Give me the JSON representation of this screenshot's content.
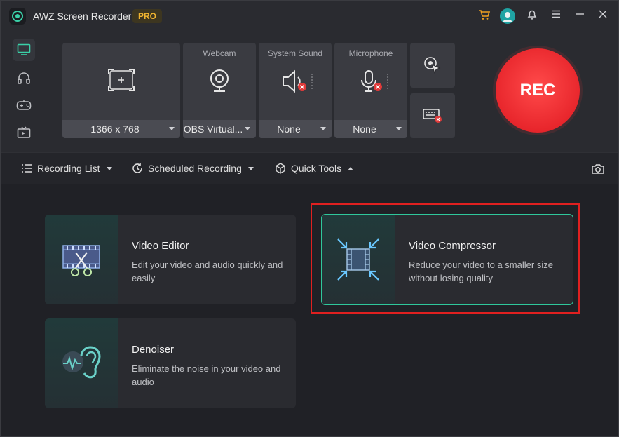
{
  "app": {
    "title": "AWZ Screen Recorder",
    "badge": "PRO"
  },
  "titlebar_icons": [
    "cart-icon",
    "avatar-icon",
    "bell-icon",
    "menu-icon",
    "minimize-icon",
    "close-icon"
  ],
  "left_nav": [
    "screen-icon",
    "headphones-icon",
    "gamepad-icon",
    "tv-icon"
  ],
  "recording": {
    "region": {
      "label": "",
      "value": "1366 x 768"
    },
    "webcam": {
      "label": "Webcam",
      "value": "OBS Virtual..."
    },
    "system_sound": {
      "label": "System Sound",
      "value": "None"
    },
    "microphone": {
      "label": "Microphone",
      "value": "None"
    },
    "rec_label": "REC"
  },
  "toolbar": {
    "recording_list": "Recording List",
    "scheduled_recording": "Scheduled Recording",
    "quick_tools": "Quick Tools"
  },
  "tools": [
    {
      "title": "Video Editor",
      "desc": "Edit your video and audio quickly and easily"
    },
    {
      "title": "Video Compressor",
      "desc": "Reduce your video to a smaller size without losing quality"
    },
    {
      "title": "Denoiser",
      "desc": "Eliminate the noise in your video and audio"
    }
  ],
  "colors": {
    "accent": "#3ad1a8",
    "rec": "#e8262c",
    "pro": "#f0b430",
    "highlight": "#e02020"
  }
}
